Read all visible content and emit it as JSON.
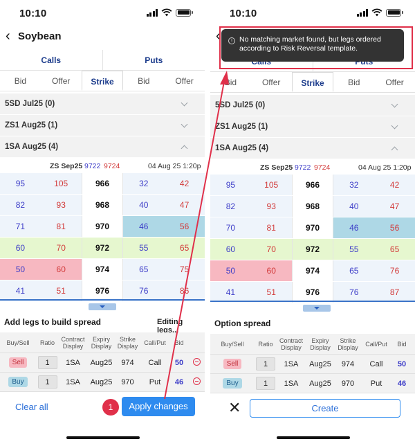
{
  "status": {
    "time": "10:10"
  },
  "nav": {
    "title": "Soybean"
  },
  "tabs": [
    "Calls",
    "Puts"
  ],
  "columns": [
    "Bid",
    "Offer",
    "Strike",
    "Bid",
    "Offer"
  ],
  "sections": [
    {
      "label": "5SD Jul25 (0)",
      "expanded": false
    },
    {
      "label": "ZS1 Aug25 (1)",
      "expanded": false
    },
    {
      "label": "1SA Aug25 (4)",
      "expanded": true
    }
  ],
  "market": {
    "contract": "ZS Sep25",
    "bid": "9722",
    "ask": "9724",
    "datetime": "04 Aug 25 1:20p"
  },
  "grid_left": [
    [
      "95",
      "105",
      "966",
      "32",
      "42"
    ],
    [
      "82",
      "93",
      "968",
      "40",
      "47"
    ],
    [
      "71",
      "81",
      "970",
      "46",
      "56"
    ],
    [
      "60",
      "70",
      "972",
      "55",
      "65"
    ],
    [
      "50",
      "60",
      "974",
      "65",
      "75"
    ],
    [
      "41",
      "51",
      "976",
      "76",
      "86"
    ]
  ],
  "grid_right": [
    [
      "95",
      "105",
      "966",
      "32",
      "42"
    ],
    [
      "82",
      "93",
      "968",
      "40",
      "47"
    ],
    [
      "70",
      "81",
      "970",
      "46",
      "56"
    ],
    [
      "60",
      "70",
      "972",
      "55",
      "65"
    ],
    [
      "50",
      "60",
      "974",
      "65",
      "76"
    ],
    [
      "41",
      "51",
      "976",
      "76",
      "87"
    ]
  ],
  "left_panel": {
    "title": "Add legs to build spread",
    "editing": "Editing legs...",
    "clear_all": "Clear all",
    "apply": "Apply changes",
    "step": "1"
  },
  "right_panel": {
    "title": "Option spread",
    "create": "Create",
    "close": "✕",
    "toast": "No matching market found, but legs ordered according to Risk Reversal template."
  },
  "legs_headers": [
    "Buy/Sell",
    "Ratio",
    "Contract Display",
    "Expiry Display",
    "Strike Display",
    "Call/Put",
    "Bid"
  ],
  "legs": [
    {
      "side": "Sell",
      "ratio": "1",
      "contract": "1SA",
      "expiry": "Aug25",
      "strike": "974",
      "cp": "Call",
      "bid": "50"
    },
    {
      "side": "Buy",
      "ratio": "1",
      "contract": "1SA",
      "expiry": "Aug25",
      "strike": "970",
      "cp": "Put",
      "bid": "46"
    }
  ],
  "colors": {
    "accent": "#2e8bef",
    "bid": "#3d3dc8",
    "offer": "#d23a3a",
    "annotation": "#e0304a"
  }
}
